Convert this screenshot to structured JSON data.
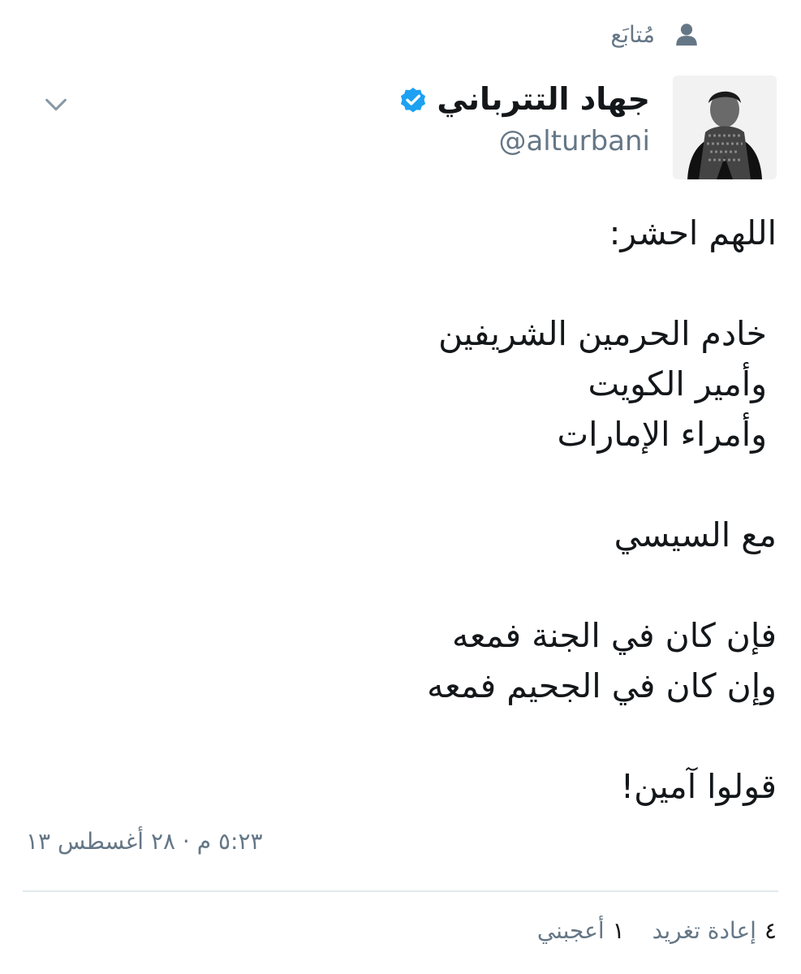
{
  "header": {
    "follow_label": "مُتابَع"
  },
  "author": {
    "name": "جهاد التترباني",
    "handle": "@alturbani",
    "verified": true
  },
  "tweet": {
    "lines": [
      "اللهم احشر:",
      "",
      "خادم الحرمين الشريفين",
      "وأمير الكويت",
      "وأمراء الإمارات",
      "",
      "مع السيسي",
      "",
      "فإن كان في الجنة فمعه",
      "وإن كان في الجحيم فمعه",
      "",
      "قولوا آمين!"
    ],
    "timestamp": "٥:٢٣ م · ٢٨ أغسطس ١٣"
  },
  "stats": {
    "retweets_count": "٤",
    "retweets_label": "إعادة تغريد",
    "likes_count": "١",
    "likes_label": "أعجبني"
  },
  "colors": {
    "verified_blue": "#1da1f2",
    "muted_gray": "#657786",
    "divider": "#e1e8ed"
  }
}
